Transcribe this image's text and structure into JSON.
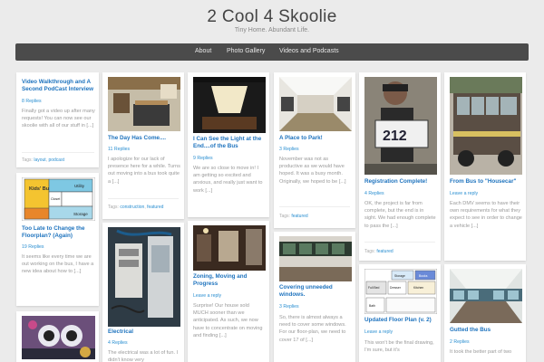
{
  "site": {
    "title": "2 Cool 4 Skoolie",
    "tagline": "Tiny Home. Abundant Life."
  },
  "nav": [
    "About",
    "Photo Gallery",
    "Videos and Podcasts"
  ],
  "posts": {
    "video": {
      "title": "Video Walkthrough and A Second PodCast Interview",
      "meta": "8 Replies",
      "excerpt": "Finally got a video up after many requests! You can now see our skoolie with all of our stuff in [...]",
      "tags_label": "Tags:",
      "tag1": "layout",
      "tag2": "podcast"
    },
    "floorplan_again": {
      "title": "Too Late to Change the Floorplan? (Again)",
      "meta": "19 Replies",
      "excerpt": "It seems like every time we are out working on the bus, I have a new idea about how to [...]",
      "img_kids": "Kids' Bunks",
      "img_utility": "Utility",
      "img_storage": "Storage",
      "img_closet": "Closet"
    },
    "day_came": {
      "title": "The Day Has Come....",
      "meta": "11 Replies",
      "excerpt": "I apologize for our lack of presence here for a while. Turns out moving into a bus took quite a [...]",
      "tags_label": "Tags:",
      "tag1": "construction",
      "tag2": "featured"
    },
    "electrical": {
      "title": "Electrical",
      "meta": "4 Replies",
      "excerpt": "The electrical was a lot of fun. I didn't know very"
    },
    "light_end": {
      "title": "I Can See the Light at the End....of the Bus",
      "meta": "9 Replies",
      "excerpt": "We are so close to move in! I am getting so excited and anxious, and really just want to work [...]"
    },
    "zoning": {
      "title": "Zoning, Moving and Progress",
      "meta": "Leave a reply",
      "excerpt": "Surprise! Our house sold MUCH sooner than we anticipated. As such, we now have to concentrate on moving and finding [...]"
    },
    "place_park": {
      "title": "A Place to Park!",
      "meta": "3 Replies",
      "excerpt": "November was not as productive as we would have hoped. It was a busy month. Originally, we hoped to be [...]",
      "tags_label": "Tags:",
      "tag1": "featured"
    },
    "covering": {
      "title": "Covering unneeded windows.",
      "meta": "3 Replies",
      "excerpt": "So, there is almost always a need to cover some windows. For our floor-plan, we need to cover 17 of [...]"
    },
    "registration": {
      "title": "Registration Complete!",
      "meta": "4 Replies",
      "excerpt": "OK, the project is far from complete, but the end is in sight. We had enough complete to pass the [...]",
      "tags_label": "Tags:",
      "tag1": "featured",
      "plate": "212"
    },
    "floorplan_v2": {
      "title": "Updated Floor Plan (v. 2)",
      "meta": "Leave a reply",
      "excerpt": "This won't be the final drawing, I'm sure, but it's",
      "img_storage": "Storage",
      "img_books": "Books",
      "img_full_bed": "Full Bed",
      "img_dresser": "Dresser",
      "img_kitchen": "Kitchen",
      "img_bath": "Bath"
    },
    "housecar": {
      "title": "From Bus to \"Housecar\"",
      "meta": "Leave a reply",
      "excerpt": "Each DMV seems to have their own requirements for what they expect to see in order to change a vehicle [...]"
    },
    "gutted": {
      "title": "Gutted the Bus",
      "meta": "2 Replies",
      "excerpt": "It took the better part of two"
    }
  }
}
